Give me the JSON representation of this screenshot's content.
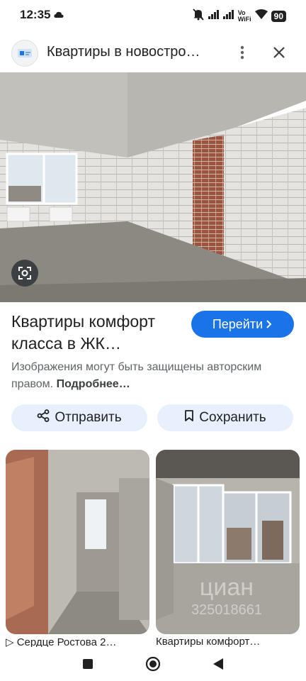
{
  "status_bar": {
    "time": "12:35",
    "vowifi": [
      "Vo",
      "WiFi"
    ],
    "battery": "90"
  },
  "header": {
    "title": "Квартиры в новостро…",
    "site_logo_icon": "site-logo-icon",
    "menu_icon": "more-vert-icon",
    "close_icon": "close-icon"
  },
  "result": {
    "title": "Квартиры комфорт класса в ЖК…",
    "go_button": "Перейти",
    "copyright_text": "Изображения могут быть защищены авторским правом.",
    "more_link": "Подробнее…",
    "share_button": "Отправить",
    "save_button": "Сохранить"
  },
  "related": [
    {
      "caption": "Сердце Ростова 2…"
    },
    {
      "caption": "Квартиры комфорт…",
      "watermark_id": "325018661"
    }
  ],
  "colors": {
    "accent": "#1a73e8",
    "chip_bg": "#e8f0fe",
    "lens_bg": "#3c4043"
  }
}
